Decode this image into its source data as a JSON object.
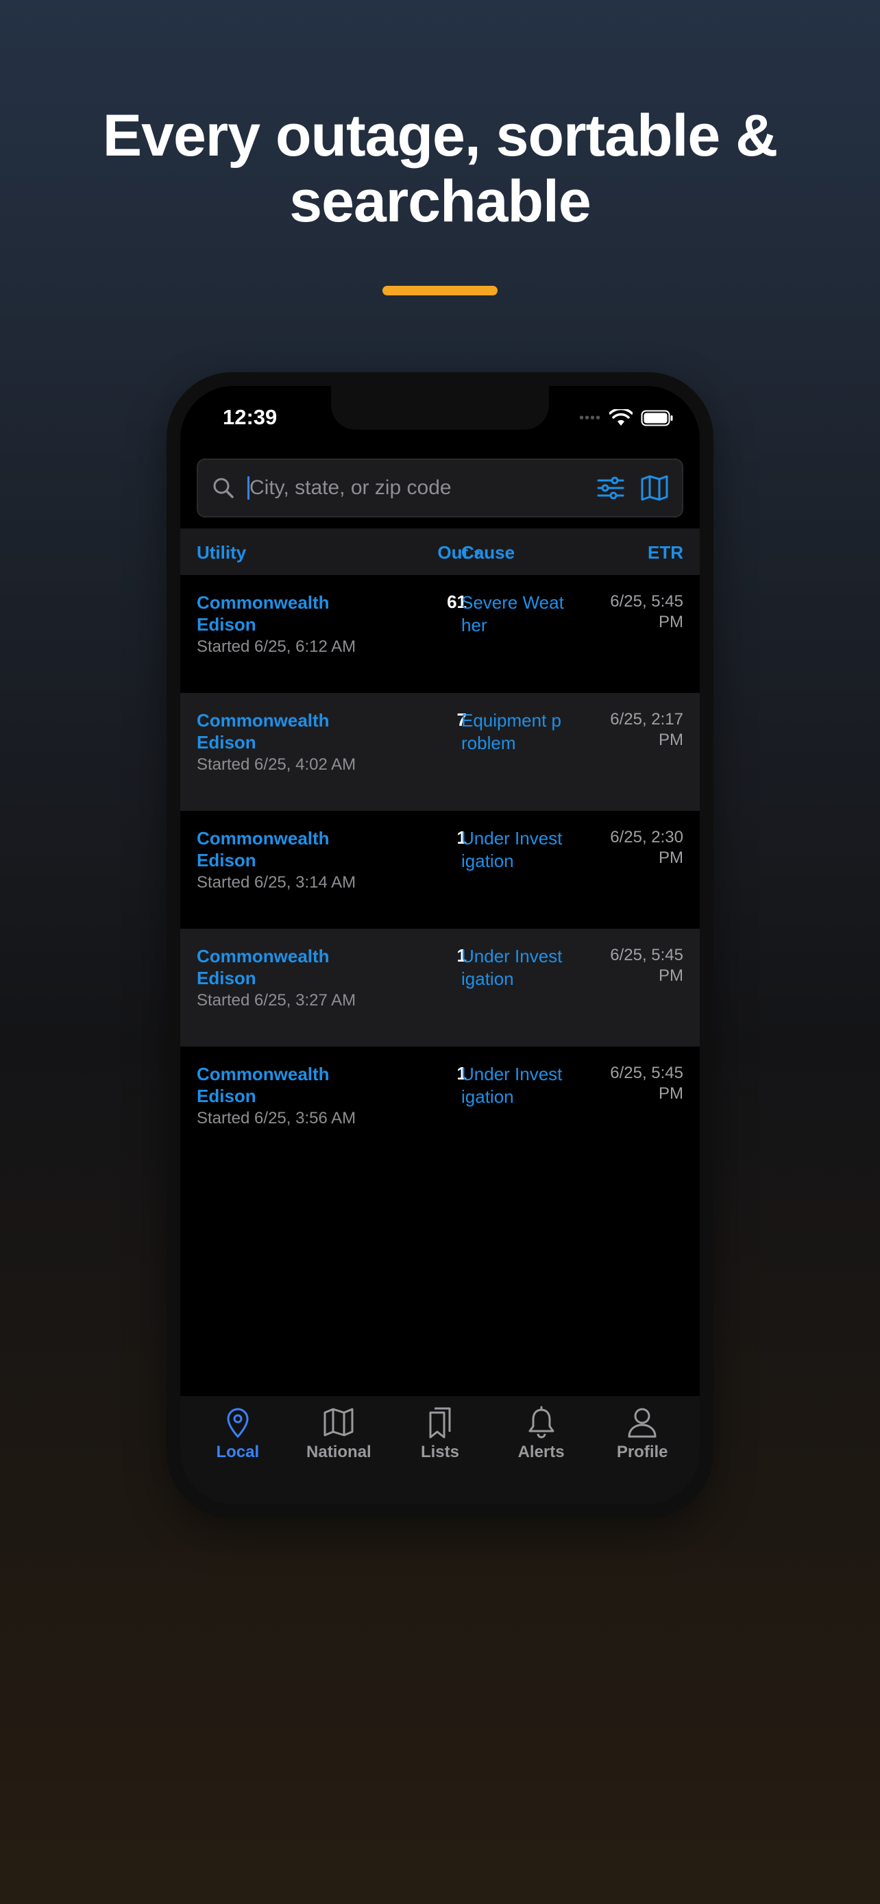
{
  "headline": {
    "line1": "Every outage, sortable &",
    "line2": "searchable"
  },
  "colors": {
    "accent": "#f5a623",
    "link": "#1e90e8",
    "active_tab": "#3a82f7"
  },
  "status_bar": {
    "time": "12:39"
  },
  "search": {
    "placeholder": "City, state, or zip code",
    "value": ""
  },
  "table": {
    "headers": {
      "utility": "Utility",
      "out": "Out",
      "cause": "Cause",
      "etr": "ETR"
    },
    "rows": [
      {
        "utility": "Commonwealth Edison",
        "started": "Started 6/25, 6:12 AM",
        "out": "61",
        "cause": "Severe Weather",
        "etr": "6/25, 5:45 PM"
      },
      {
        "utility": "Commonwealth Edison",
        "started": "Started 6/25, 4:02 AM",
        "out": "7",
        "cause": "Equipment problem",
        "etr": "6/25, 2:17 PM"
      },
      {
        "utility": "Commonwealth Edison",
        "started": "Started 6/25, 3:14 AM",
        "out": "1",
        "cause": "Under Investigation",
        "etr": "6/25, 2:30 PM"
      },
      {
        "utility": "Commonwealth Edison",
        "started": "Started 6/25, 3:27 AM",
        "out": "1",
        "cause": "Under Investigation",
        "etr": "6/25, 5:45 PM"
      },
      {
        "utility": "Commonwealth Edison",
        "started": "Started 6/25, 3:56 AM",
        "out": "1",
        "cause": "Under Investigation",
        "etr": "6/25, 5:45 PM"
      }
    ]
  },
  "tabs": [
    {
      "label": "Local",
      "icon": "location-pin-icon",
      "active": true
    },
    {
      "label": "National",
      "icon": "map-icon",
      "active": false
    },
    {
      "label": "Lists",
      "icon": "bookmarks-icon",
      "active": false
    },
    {
      "label": "Alerts",
      "icon": "bell-icon",
      "active": false
    },
    {
      "label": "Profile",
      "icon": "person-icon",
      "active": false
    }
  ]
}
